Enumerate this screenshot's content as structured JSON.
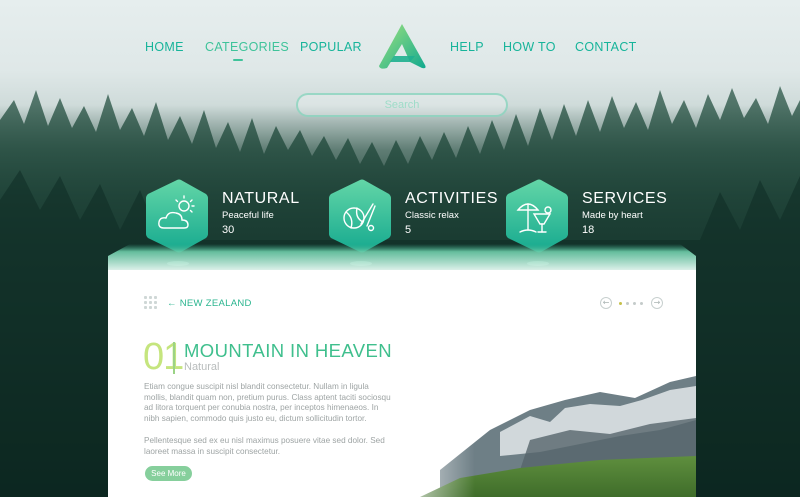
{
  "nav": {
    "items": [
      "HOME",
      "CATEGORIES",
      "POPULAR",
      "HELP",
      "HOW TO",
      "CONTACT"
    ],
    "active": "CATEGORIES"
  },
  "search": {
    "placeholder": "Search"
  },
  "features": [
    {
      "title": "NATURAL",
      "subtitle": "Peaceful life",
      "count": "30",
      "icon": "weather-cloud-sun-icon"
    },
    {
      "title": "ACTIVITIES",
      "subtitle": "Classic relax",
      "count": "5",
      "icon": "sports-balls-icon"
    },
    {
      "title": "SERVICES",
      "subtitle": "Made by heart",
      "count": "18",
      "icon": "beach-cocktail-icon"
    }
  ],
  "card": {
    "breadcrumb": "← NEW ZEALAND",
    "number": "01",
    "title": "MOUNTAIN IN HEAVEN",
    "category": "Natural",
    "paragraph1": "Etiam congue suscipit nisl blandit consectetur. Nullam in ligula mollis, blandit quam non, pretium purus. Class aptent taciti sociosqu ad litora torquent per conubia nostra, per inceptos himenaeos. In nibh sapien, commodo quis justo eu, dictum sollicitudin tortor.",
    "paragraph2": "Pellentesque sed ex eu nisl maximus posuere vitae sed dolor. Sed laoreet massa in suscipit consectetur.",
    "button": "See More",
    "pager": {
      "prev": "←",
      "next": "→",
      "dots": 4,
      "active_dot": 1
    }
  },
  "colors": {
    "accent": "#17b49a",
    "hex_gradient_top": "#63d6a7",
    "hex_gradient_bottom": "#15a98f",
    "title_green": "#3fbf8d",
    "number_lime": "#c5e57e",
    "button_green": "#86cf9c"
  }
}
